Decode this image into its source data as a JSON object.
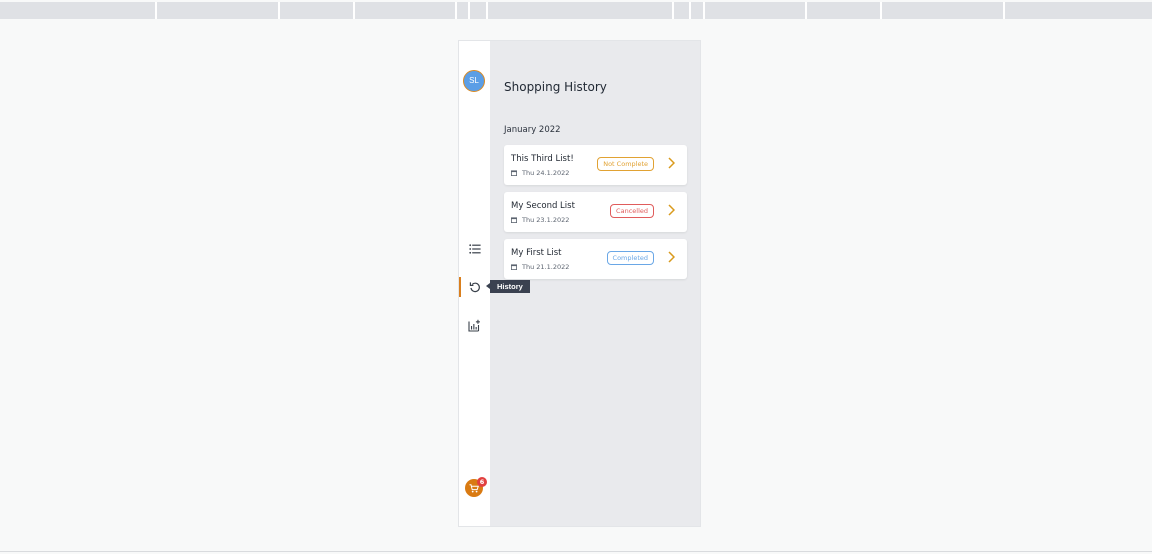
{
  "colors": {
    "accent": "#d97f1e",
    "avatar": "#5b9ee6",
    "not_complete": "#e1a233",
    "cancelled": "#e05c5c",
    "completed": "#6aa7e6"
  },
  "user": {
    "initials": "SL"
  },
  "nav": [
    {
      "name": "lists",
      "icon": "list-icon"
    },
    {
      "name": "history",
      "icon": "history-icon",
      "active": true
    },
    {
      "name": "statistics",
      "icon": "chart-add-icon"
    }
  ],
  "tooltip": "History",
  "cart": {
    "icon": "cart-icon",
    "count": "6"
  },
  "page": {
    "title": "Shopping History",
    "month": "January 2022",
    "lists": [
      {
        "name": "This Third List!",
        "date": "Thu 24.1.2022",
        "status": "Not Complete",
        "status_color": "#e1a233"
      },
      {
        "name": "My Second List",
        "date": "Thu 23.1.2022",
        "status": "Cancelled",
        "status_color": "#e05c5c"
      },
      {
        "name": "My First List",
        "date": "Thu 21.1.2022",
        "status": "Completed",
        "status_color": "#6aa7e6"
      }
    ]
  }
}
